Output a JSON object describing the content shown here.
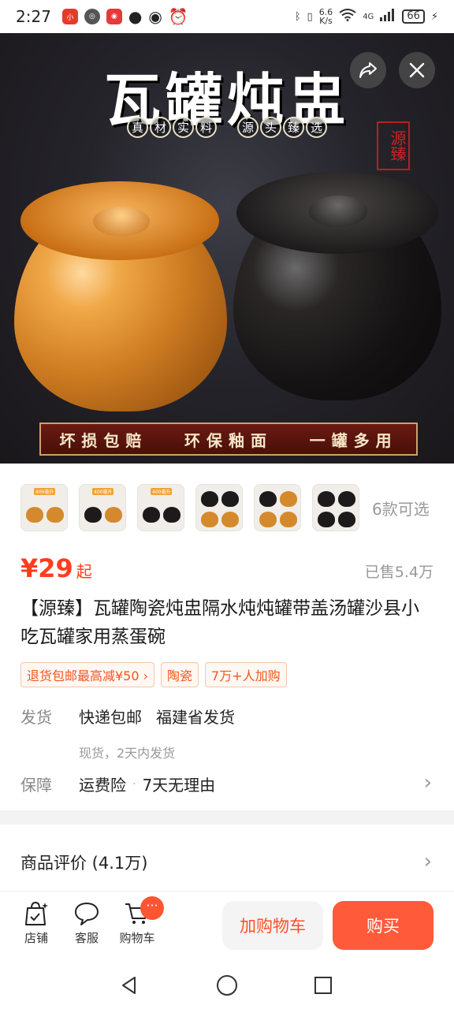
{
  "status_bar": {
    "time": "2:27",
    "net_speed": "6.6\nK/s",
    "net_type": "4G",
    "battery": "66"
  },
  "hero": {
    "title": "瓦罐炖盅",
    "seal_text": "源臻",
    "tag_groups": [
      [
        "真",
        "材",
        "实",
        "料"
      ],
      [
        "源",
        "头",
        "臻",
        "选"
      ]
    ],
    "banner": [
      "坏损包赔",
      "环保釉面",
      "一罐多用"
    ]
  },
  "variants": {
    "count_label": "6款可选",
    "thumb_label": "400毫升"
  },
  "price": {
    "value": "¥29",
    "suffix": "起",
    "sold": "已售5.4万"
  },
  "product_title": "【源臻】瓦罐陶瓷炖盅隔水炖炖罐带盖汤罐沙县小吃瓦罐家用蒸蛋碗",
  "chips": [
    "退货包邮最高减¥50 ›",
    "陶瓷",
    "7万+人加购"
  ],
  "shipping": {
    "label": "发货",
    "method": "快递包邮",
    "origin": "福建省发货",
    "note": "现货，2天内发货"
  },
  "guarantee": {
    "label": "保障",
    "items": [
      "运费险",
      "7天无理由"
    ]
  },
  "review": {
    "label": "商品评价 (4.1万)"
  },
  "bottom_bar": {
    "store": "店铺",
    "service": "客服",
    "cart": "购物车",
    "cart_badge": "···",
    "add_to_cart": "加购物车",
    "buy_now": "购买"
  }
}
